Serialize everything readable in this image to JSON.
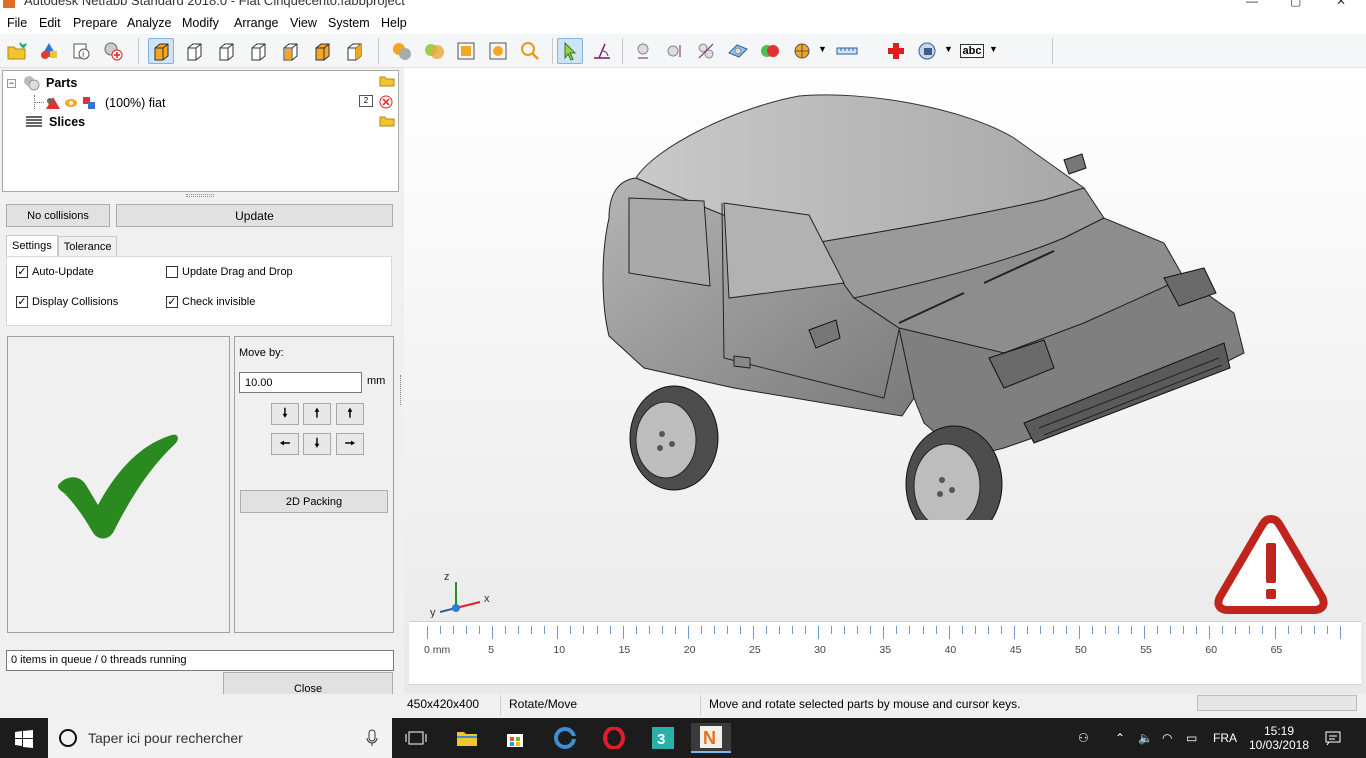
{
  "window": {
    "title": "Autodesk Netfabb Standard 2018.0 - Fiat Cinquecento.fabbproject"
  },
  "menu": [
    "File",
    "Edit",
    "Prepare",
    "Analyze",
    "Modify",
    "Arrange",
    "View",
    "System",
    "Help"
  ],
  "toolbar": {
    "icons": [
      "open-folder-icon",
      "add-parts-icon",
      "part-info-icon",
      "add-mesh-icon",
      "view-iso-icon",
      "view-front-icon",
      "view-back-icon",
      "view-left-icon",
      "view-right-icon",
      "view-top-icon",
      "view-bottom-icon",
      "shading-icon",
      "texture-icon",
      "zoom-fit-icon",
      "zoom-selection-icon",
      "zoom-icon",
      "select-cursor-icon",
      "rotate-move-icon",
      "sphere-icon",
      "spheres-icon",
      "support-icon",
      "plane-icon",
      "color-spheres-icon",
      "section-icon",
      "measure-icon",
      "repair-cross-icon",
      "camera-icon",
      "label-abc-icon"
    ],
    "label_tool_text": "abc"
  },
  "tree": {
    "parts_label": "Parts",
    "part_label": "(100%) fiat",
    "part_count_badge": "2",
    "slices_label": "Slices"
  },
  "collision": {
    "status_button": "No collisions",
    "update_button": "Update",
    "tabs": [
      "Settings",
      "Tolerance"
    ],
    "options": [
      {
        "label": "Auto-Update",
        "checked": true
      },
      {
        "label": "Update Drag and Drop",
        "checked": false
      },
      {
        "label": "Display Collisions",
        "checked": true
      },
      {
        "label": "Check invisible",
        "checked": true
      }
    ]
  },
  "move": {
    "label": "Move by:",
    "value": "10.00",
    "unit": "mm",
    "packing_button": "2D Packing"
  },
  "queue_status": "0 items in queue / 0 threads running",
  "close_button": "Close",
  "ruler": {
    "labels": [
      "0 mm",
      "5",
      "10",
      "15",
      "20",
      "25",
      "30",
      "35",
      "40",
      "45",
      "50",
      "55",
      "60",
      "65"
    ]
  },
  "axes": {
    "x": "x",
    "y": "y",
    "z": "z"
  },
  "statusbar": {
    "dimensions": "450x420x400",
    "mode": "Rotate/Move",
    "hint": "Move and rotate selected parts by mouse and cursor keys."
  },
  "taskbar": {
    "search_placeholder": "Taper ici pour rechercher",
    "lang": "FRA",
    "time": "15:19",
    "date": "10/03/2018"
  },
  "colors": {
    "accent": "#0078d7",
    "ok_green": "#2a8a1f",
    "warning_red": "#c0241c"
  }
}
